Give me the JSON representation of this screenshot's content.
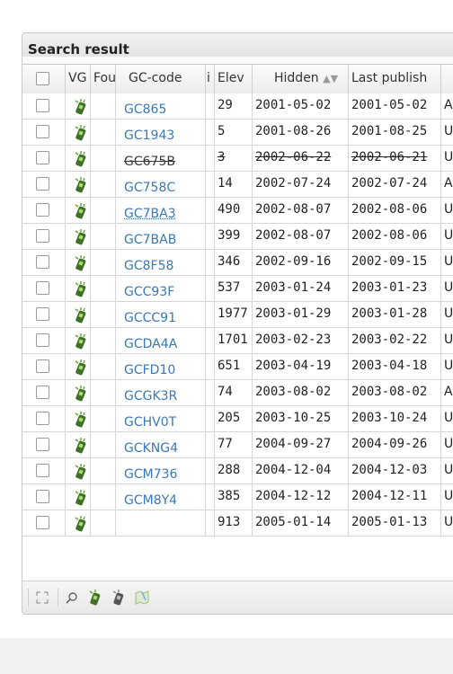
{
  "panel": {
    "title": "Search result"
  },
  "columns": {
    "vg": "VG",
    "found": "Fou",
    "gc_code": "GC-code",
    "info": "i",
    "elev": "Elev",
    "hidden": "Hidden",
    "hidden_sort_icon": "sort-arrows-icon",
    "last_publish": "Last publish"
  },
  "rows": [
    {
      "gc": "GC865",
      "elev": "29",
      "hidden": "2001-05-02",
      "last": "2001-05-02",
      "rest": "A"
    },
    {
      "gc": "GC1943",
      "elev": "5",
      "hidden": "2001-08-26",
      "last": "2001-08-25",
      "rest": "U"
    },
    {
      "gc": "GC675B",
      "elev": "3",
      "hidden": "2002-06-22",
      "last": "2002-06-21",
      "rest": "U"
    },
    {
      "gc": "GC758C",
      "elev": "14",
      "hidden": "2002-07-24",
      "last": "2002-07-24",
      "rest": "A"
    },
    {
      "gc": "GC7BA3",
      "elev": "490",
      "hidden": "2002-08-07",
      "last": "2002-08-06",
      "rest": "U"
    },
    {
      "gc": "GC7BAB",
      "elev": "399",
      "hidden": "2002-08-07",
      "last": "2002-08-06",
      "rest": "U"
    },
    {
      "gc": "GC8F58",
      "elev": "346",
      "hidden": "2002-09-16",
      "last": "2002-09-15",
      "rest": "U"
    },
    {
      "gc": "GCC93F",
      "elev": "537",
      "hidden": "2003-01-24",
      "last": "2003-01-23",
      "rest": "U"
    },
    {
      "gc": "GCCC91",
      "elev": "1977",
      "hidden": "2003-01-29",
      "last": "2003-01-28",
      "rest": "U"
    },
    {
      "gc": "GCDA4A",
      "elev": "1701",
      "hidden": "2003-02-23",
      "last": "2003-02-22",
      "rest": "U"
    },
    {
      "gc": "GCFD10",
      "elev": "651",
      "hidden": "2003-04-19",
      "last": "2003-04-18",
      "rest": "U"
    },
    {
      "gc": "GCGK3R",
      "elev": "74",
      "hidden": "2003-08-02",
      "last": "2003-08-02",
      "rest": "A"
    },
    {
      "gc": "GCHV0T",
      "elev": "205",
      "hidden": "2003-10-25",
      "last": "2003-10-24",
      "rest": "U"
    },
    {
      "gc": "GCKNG4",
      "elev": "77",
      "hidden": "2004-09-27",
      "last": "2004-09-26",
      "rest": "U"
    },
    {
      "gc": "GCM736",
      "elev": "288",
      "hidden": "2004-12-04",
      "last": "2004-12-03",
      "rest": "U"
    },
    {
      "gc": "GCM8Y4",
      "elev": "385",
      "hidden": "2004-12-12",
      "last": "2004-12-11",
      "rest": "U"
    },
    {
      "gc": "",
      "elev": "913",
      "hidden": "2005-01-14",
      "last": "2005-01-13",
      "rest": "U"
    }
  ],
  "colors": {
    "link": "#3a78b8",
    "icon_green": "#5aaa2a"
  },
  "icons": {
    "row_type": "gps-device-icon",
    "toolbar": [
      "fullscreen-icon",
      "search-icon",
      "gps-add-icon",
      "gps-remove-icon",
      "map-icon"
    ]
  }
}
